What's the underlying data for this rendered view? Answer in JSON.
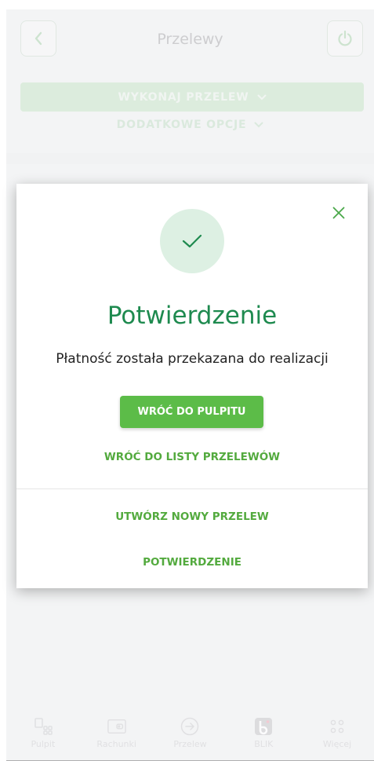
{
  "header": {
    "title": "Przelewy"
  },
  "menu": {
    "primary_label": "WYKONAJ PRZELEW",
    "secondary_label": "DODATKOWE OPCJE"
  },
  "modal": {
    "title": "Potwierdzenie",
    "message": "Płatność została przekazana do realizacji",
    "main_button": "WRÓĆ DO PULPITU",
    "link_list": "WRÓĆ DO LISTY PRZELEWÓW",
    "link_new": "UTWÓRZ NOWY PRZELEW",
    "link_confirm": "POTWIERDZENIE"
  },
  "bottom_nav": {
    "items": [
      {
        "label": "Pulpit",
        "icon": "dashboard-icon"
      },
      {
        "label": "Rachunki",
        "icon": "wallet-icon"
      },
      {
        "label": "Przelew",
        "icon": "arrow-circle-icon"
      },
      {
        "label": "BLIK",
        "icon": "blik-icon"
      },
      {
        "label": "Więcej",
        "icon": "more-dots-icon"
      }
    ]
  },
  "colors": {
    "brand_green": "#5cbc48",
    "title_green": "#1e8a4f",
    "check_bg": "#ddf0e3"
  }
}
